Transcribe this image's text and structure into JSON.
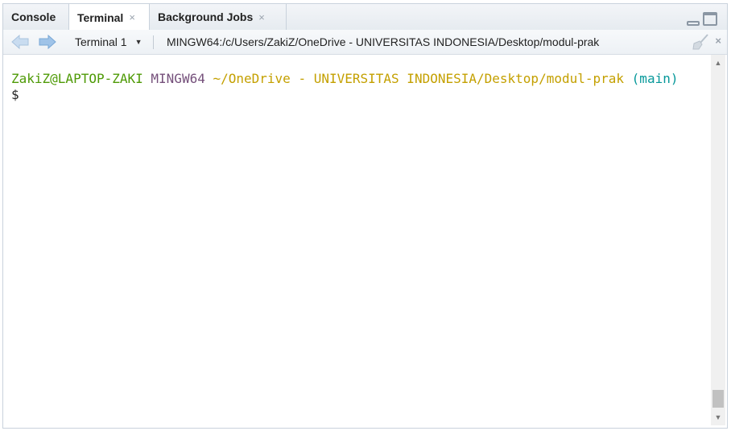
{
  "tabs": [
    {
      "label": "Console",
      "closable": false,
      "active": false
    },
    {
      "label": "Terminal",
      "closable": true,
      "active": true
    },
    {
      "label": "Background Jobs",
      "closable": true,
      "active": false
    }
  ],
  "tab_close_glyph": "×",
  "toolbar": {
    "terminal_select": "Terminal 1",
    "path": "MINGW64:/c/Users/ZakiZ/OneDrive - UNIVERSITAS INDONESIA/Desktop/modul-prak",
    "close_glyph": "×"
  },
  "terminal": {
    "user_host": "ZakiZ@LAPTOP-ZAKI",
    "system": "MINGW64",
    "cwd": "~/OneDrive - UNIVERSITAS INDONESIA/Desktop/modul-prak",
    "branch": "(main)",
    "prompt": "$"
  },
  "colors": {
    "user": "#4e9a06",
    "system": "#75507b",
    "cwd": "#c4a000",
    "branch": "#06989a"
  },
  "icons": [
    "back-arrow-icon",
    "forward-arrow-icon",
    "broom-icon",
    "minimize-icon",
    "maximize-icon"
  ]
}
